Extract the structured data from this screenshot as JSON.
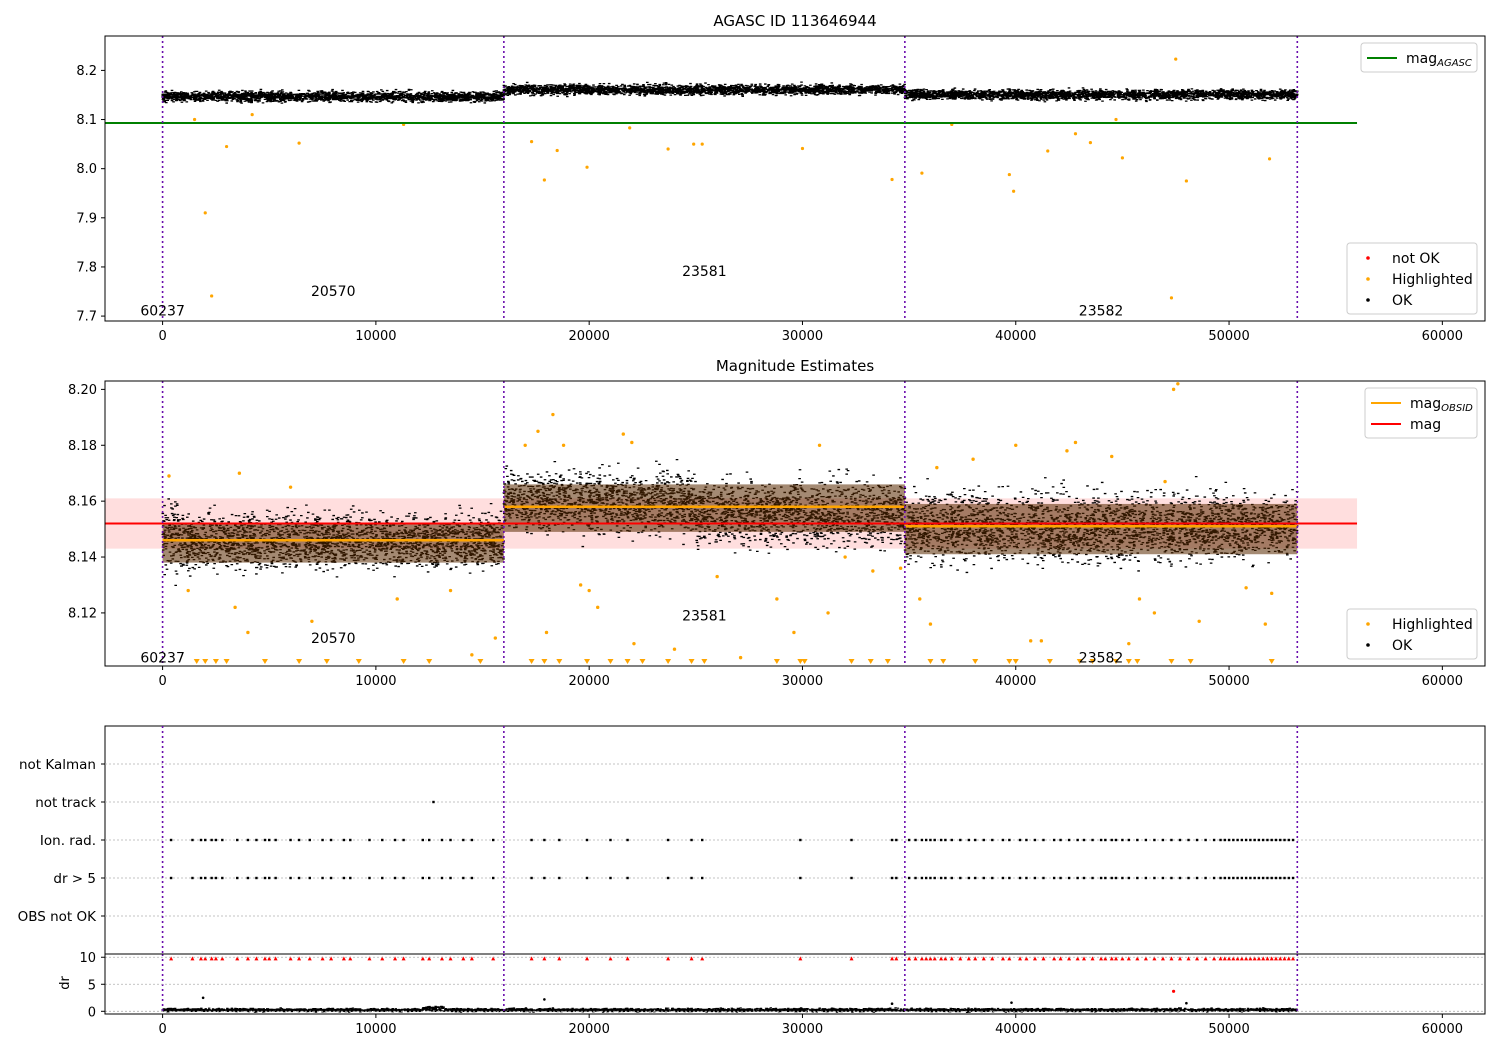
{
  "chart_data": [
    {
      "type": "scatter",
      "title": "AGASC ID 113646944",
      "xlabel": "",
      "ylabel": "",
      "xlim": [
        -2700,
        62000
      ],
      "ylim": [
        7.69,
        8.27
      ],
      "xticks": [
        0,
        10000,
        20000,
        30000,
        40000,
        50000,
        60000
      ],
      "yticks": [
        7.7,
        7.8,
        7.9,
        8.0,
        8.1,
        8.2
      ],
      "ytick_decimals": 1,
      "grid": false,
      "legends": [
        {
          "placement": "upper-right",
          "entries": [
            {
              "label": "mag",
              "subscript": "AGASC",
              "color": "#008000",
              "marker": "line"
            }
          ]
        },
        {
          "placement": "lower-right",
          "entries": [
            {
              "label": "not OK",
              "color": "#ff0000",
              "marker": "dot"
            },
            {
              "label": "Highlighted",
              "color": "#ffa500",
              "marker": "dot"
            },
            {
              "label": "OK",
              "color": "#000000",
              "marker": "dot"
            }
          ]
        }
      ],
      "vlines": [
        0,
        16000,
        34800,
        53200
      ],
      "hlines": [
        {
          "y": 8.093,
          "x": [
            -2700,
            56000
          ],
          "color": "#008000"
        }
      ],
      "obsid_labels": [
        {
          "text": "60237",
          "x": 0,
          "y": 7.711
        },
        {
          "text": "20570",
          "x": 8000,
          "y": 7.751
        },
        {
          "text": "23581",
          "x": 25400,
          "y": 7.792
        },
        {
          "text": "23582",
          "x": 44000,
          "y": 7.711
        }
      ],
      "ok_band": {
        "segments": [
          {
            "x": [
              0,
              16000
            ],
            "center": 8.148,
            "spread": 0.012
          },
          {
            "x": [
              16000,
              34800
            ],
            "center": 8.162,
            "spread": 0.012
          },
          {
            "x": [
              34800,
              53200
            ],
            "center": 8.152,
            "spread": 0.012
          }
        ]
      },
      "highlighted_points": [
        [
          2000,
          7.91
        ],
        [
          2300,
          7.741
        ],
        [
          3000,
          8.045
        ],
        [
          6400,
          8.052
        ],
        [
          17300,
          8.055
        ],
        [
          17900,
          7.977
        ],
        [
          18500,
          8.037
        ],
        [
          19900,
          8.003
        ],
        [
          23700,
          8.04
        ],
        [
          24900,
          8.05
        ],
        [
          25300,
          8.05
        ],
        [
          30000,
          8.041
        ],
        [
          34200,
          7.978
        ],
        [
          35600,
          7.991
        ],
        [
          39700,
          7.988
        ],
        [
          39900,
          7.954
        ],
        [
          41500,
          8.036
        ],
        [
          42800,
          8.071
        ],
        [
          43500,
          8.053
        ],
        [
          45000,
          8.022
        ],
        [
          47300,
          7.737
        ],
        [
          47500,
          8.223
        ],
        [
          48000,
          7.975
        ],
        [
          51900,
          8.02
        ],
        [
          1500,
          8.1
        ],
        [
          4200,
          8.11
        ],
        [
          11300,
          8.09
        ],
        [
          21900,
          8.083
        ],
        [
          37000,
          8.09
        ],
        [
          44700,
          8.1
        ]
      ],
      "not_ok_points": []
    },
    {
      "type": "scatter",
      "title": "Magnitude Estimates",
      "xlabel": "",
      "ylabel": "",
      "xlim": [
        -2700,
        62000
      ],
      "ylim": [
        8.101,
        8.203
      ],
      "xticks": [
        0,
        10000,
        20000,
        30000,
        40000,
        50000,
        60000
      ],
      "yticks": [
        8.12,
        8.14,
        8.16,
        8.18,
        8.2
      ],
      "ytick_decimals": 2,
      "grid": false,
      "legends": [
        {
          "placement": "upper-right",
          "entries": [
            {
              "label": "mag",
              "subscript": "OBSID",
              "color": "#ffa500",
              "marker": "line"
            },
            {
              "label": "mag",
              "color": "#ff0000",
              "marker": "line"
            }
          ]
        },
        {
          "placement": "lower-right",
          "entries": [
            {
              "label": "Highlighted",
              "color": "#ffa500",
              "marker": "dot"
            },
            {
              "label": "OK",
              "color": "#000000",
              "marker": "dot"
            }
          ]
        }
      ],
      "vlines": [
        0,
        16000,
        34800,
        53200
      ],
      "mag_line": {
        "y": 8.152,
        "x": [
          -2700,
          56000
        ],
        "band": [
          8.143,
          8.161
        ]
      },
      "obsid_means": [
        {
          "x": [
            0,
            16000
          ],
          "y": 8.146,
          "band": [
            8.138,
            8.152
          ]
        },
        {
          "x": [
            16000,
            34800
          ],
          "y": 8.158,
          "band": [
            8.149,
            8.166
          ]
        },
        {
          "x": [
            34800,
            53200
          ],
          "y": 8.151,
          "band": [
            8.141,
            8.159
          ]
        }
      ],
      "obsid_labels": [
        {
          "text": "60237",
          "x": 0,
          "y": 8.104
        },
        {
          "text": "20570",
          "x": 8000,
          "y": 8.111
        },
        {
          "text": "23581",
          "x": 25400,
          "y": 8.119
        },
        {
          "text": "23582",
          "x": 44000,
          "y": 8.104
        }
      ],
      "ok_band": {
        "segments": [
          {
            "x": [
              0,
              1000
            ],
            "center": 8.148,
            "spread": 0.014
          },
          {
            "x": [
              1000,
              16000
            ],
            "center": 8.146,
            "spread": 0.011
          },
          {
            "x": [
              16000,
              25000
            ],
            "center": 8.16,
            "spread": 0.012
          },
          {
            "x": [
              25000,
              34800
            ],
            "center": 8.156,
            "spread": 0.013
          },
          {
            "x": [
              34800,
              53200
            ],
            "center": 8.151,
            "spread": 0.014
          }
        ]
      },
      "highlighted_points": [
        [
          300,
          8.169
        ],
        [
          1200,
          8.128
        ],
        [
          3400,
          8.122
        ],
        [
          3600,
          8.17
        ],
        [
          4000,
          8.113
        ],
        [
          6000,
          8.165
        ],
        [
          7000,
          8.117
        ],
        [
          11000,
          8.125
        ],
        [
          13500,
          8.128
        ],
        [
          14500,
          8.105
        ],
        [
          15600,
          8.111
        ],
        [
          17000,
          8.18
        ],
        [
          17600,
          8.185
        ],
        [
          18000,
          8.113
        ],
        [
          18300,
          8.191
        ],
        [
          18800,
          8.18
        ],
        [
          19600,
          8.13
        ],
        [
          20000,
          8.128
        ],
        [
          20400,
          8.122
        ],
        [
          21600,
          8.184
        ],
        [
          22000,
          8.181
        ],
        [
          22100,
          8.109
        ],
        [
          24000,
          8.107
        ],
        [
          26000,
          8.133
        ],
        [
          27100,
          8.104
        ],
        [
          28800,
          8.125
        ],
        [
          29600,
          8.113
        ],
        [
          30800,
          8.18
        ],
        [
          31200,
          8.12
        ],
        [
          32000,
          8.14
        ],
        [
          33300,
          8.135
        ],
        [
          34600,
          8.136
        ],
        [
          35500,
          8.125
        ],
        [
          36000,
          8.116
        ],
        [
          36300,
          8.172
        ],
        [
          38000,
          8.175
        ],
        [
          40000,
          8.18
        ],
        [
          40700,
          8.11
        ],
        [
          41200,
          8.11
        ],
        [
          42400,
          8.178
        ],
        [
          42800,
          8.181
        ],
        [
          44500,
          8.176
        ],
        [
          45300,
          8.109
        ],
        [
          45800,
          8.125
        ],
        [
          46500,
          8.12
        ],
        [
          47000,
          8.167
        ],
        [
          47400,
          8.2
        ],
        [
          47600,
          8.202
        ],
        [
          48600,
          8.117
        ],
        [
          50800,
          8.129
        ],
        [
          51700,
          8.116
        ],
        [
          52000,
          8.127
        ]
      ],
      "below_markers": [
        1600,
        2000,
        2500,
        3000,
        4800,
        6400,
        7700,
        9200,
        11300,
        12500,
        14900,
        17300,
        17900,
        18600,
        19900,
        21000,
        21800,
        22500,
        23700,
        24800,
        25400,
        28800,
        29900,
        30100,
        32300,
        33200,
        34000,
        36000,
        36600,
        38100,
        39700,
        40000,
        41600,
        43000,
        43600,
        44700,
        45300,
        45700,
        47300,
        48200,
        52000
      ]
    },
    {
      "type": "scatter",
      "title": "",
      "xlabel": "",
      "ylabel": "",
      "xlim": [
        -2700,
        62000
      ],
      "categories": [
        "not Kalman",
        "not track",
        "Ion. rad.",
        "dr > 5",
        "OBS not OK"
      ],
      "grid": true,
      "vlines": [
        0,
        16000,
        34800,
        53200
      ],
      "points": {
        "not track": [
          12700
        ],
        "Ion. rad.": [
          400,
          1400,
          1800,
          2000,
          2300,
          2500,
          2800,
          3500,
          4000,
          4400,
          4800,
          5000,
          5300,
          6000,
          6400,
          6900,
          7500,
          7900,
          8500,
          8800,
          9700,
          10300,
          10900,
          11300,
          12200,
          12500,
          13100,
          13500,
          14100,
          14500,
          15500,
          17300,
          17900,
          18600,
          19900,
          21000,
          21800,
          23700,
          24800,
          25300,
          29900,
          32300,
          34200,
          34400,
          35000,
          35300,
          35600,
          35800,
          36000,
          36200,
          36500,
          36700,
          37000,
          37400,
          37800,
          38100,
          38500,
          38900,
          39400,
          39700,
          40200,
          40500,
          40900,
          41300,
          41800,
          42100,
          42500,
          42900,
          43200,
          43600,
          44000,
          44200,
          44500,
          44700,
          45000,
          45300,
          45700,
          46100,
          46500,
          46900,
          47300,
          47700,
          48100,
          48500,
          48900,
          49300,
          49600,
          49800,
          50000,
          50200,
          50400,
          50600,
          50800,
          51000,
          51200,
          51400,
          51600,
          51800,
          52000,
          52200,
          52400,
          52600,
          52800,
          53000
        ],
        "dr > 5": [
          400,
          1400,
          1800,
          2000,
          2300,
          2500,
          2800,
          3500,
          4000,
          4400,
          4800,
          5000,
          5300,
          6000,
          6400,
          6900,
          7500,
          7900,
          8500,
          8800,
          9700,
          10300,
          10900,
          11300,
          12200,
          12500,
          13100,
          13500,
          14100,
          14500,
          15500,
          17300,
          17900,
          18600,
          19900,
          21000,
          21800,
          23700,
          24800,
          25300,
          29900,
          32300,
          34200,
          34400,
          35000,
          35300,
          35600,
          35800,
          36000,
          36200,
          36500,
          36700,
          37000,
          37400,
          37800,
          38100,
          38500,
          38900,
          39400,
          39700,
          40200,
          40500,
          40900,
          41300,
          41800,
          42100,
          42500,
          42900,
          43200,
          43600,
          44000,
          44200,
          44500,
          44700,
          45000,
          45300,
          45700,
          46100,
          46500,
          46900,
          47300,
          47700,
          48100,
          48500,
          48900,
          49300,
          49600,
          49800,
          50000,
          50200,
          50400,
          50600,
          50800,
          51000,
          51200,
          51400,
          51600,
          51800,
          52000,
          52200,
          52400,
          52600,
          52800,
          53000
        ]
      }
    },
    {
      "type": "scatter",
      "title": "",
      "xlabel": "",
      "ylabel": "dr",
      "xlim": [
        -2700,
        62000
      ],
      "ylim": [
        -0.5,
        10.6
      ],
      "xticks": [
        0,
        10000,
        20000,
        30000,
        40000,
        50000,
        60000
      ],
      "yticks": [
        0,
        5,
        10
      ],
      "ytick_decimals": 0,
      "grid": true,
      "vlines": [
        0,
        16000,
        34800,
        53200
      ],
      "ok_band": {
        "segments": [
          {
            "x": [
              0,
              12200
            ],
            "center": 0.35,
            "spread": 0.35
          },
          {
            "x": [
              12200,
              13200
            ],
            "center": 0.6,
            "spread": 0.6
          },
          {
            "x": [
              13200,
              53200
            ],
            "center": 0.35,
            "spread": 0.35
          }
        ]
      },
      "outliers": [
        [
          1900,
          2.5
        ],
        [
          17900,
          2.2
        ],
        [
          34200,
          1.4
        ],
        [
          39800,
          1.6
        ],
        [
          47400,
          3.7
        ],
        [
          48000,
          1.5
        ]
      ],
      "capped_markers": [
        400,
        1400,
        1800,
        2000,
        2300,
        2500,
        2800,
        3500,
        4000,
        4400,
        4800,
        5000,
        5300,
        6000,
        6400,
        6900,
        7500,
        7900,
        8500,
        8800,
        9700,
        10300,
        10900,
        11300,
        12200,
        12500,
        13100,
        13500,
        14100,
        14500,
        15500,
        17300,
        17900,
        18600,
        19900,
        21000,
        21800,
        23700,
        24800,
        25300,
        29900,
        32300,
        34200,
        34400,
        35000,
        35300,
        35600,
        35800,
        36000,
        36200,
        36500,
        36700,
        37000,
        37400,
        37800,
        38100,
        38500,
        38900,
        39400,
        39700,
        40200,
        40500,
        40900,
        41300,
        41800,
        42100,
        42500,
        42900,
        43200,
        43600,
        44000,
        44200,
        44500,
        44700,
        45000,
        45300,
        45700,
        46100,
        46500,
        46900,
        47300,
        47700,
        48100,
        48500,
        48900,
        49300,
        49600,
        49800,
        50000,
        50200,
        50400,
        50600,
        50800,
        51000,
        51200,
        51400,
        51600,
        51800,
        52000,
        52200,
        52400,
        52600,
        52800,
        53000
      ]
    }
  ]
}
